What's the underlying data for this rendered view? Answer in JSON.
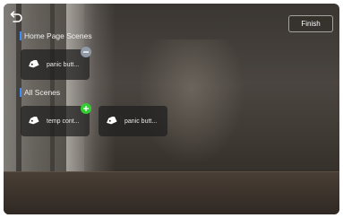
{
  "header": {
    "finish_label": "Finish",
    "back_icon": "back-arrow-icon"
  },
  "home_section": {
    "title": "Home Page Scenes",
    "scenes": [
      {
        "label": "panic butt...",
        "icon": "tag-icon",
        "action": "remove"
      }
    ]
  },
  "all_section": {
    "title": "All Scenes",
    "scenes": [
      {
        "label": "temp cont...",
        "icon": "tag-icon",
        "action": "add"
      },
      {
        "label": "panic butt...",
        "icon": "tag-icon",
        "action": "none"
      }
    ]
  },
  "colors": {
    "accent_bar": "#3a8eff",
    "add_badge": "#33cc33",
    "remove_badge": "#8f9aa6"
  }
}
